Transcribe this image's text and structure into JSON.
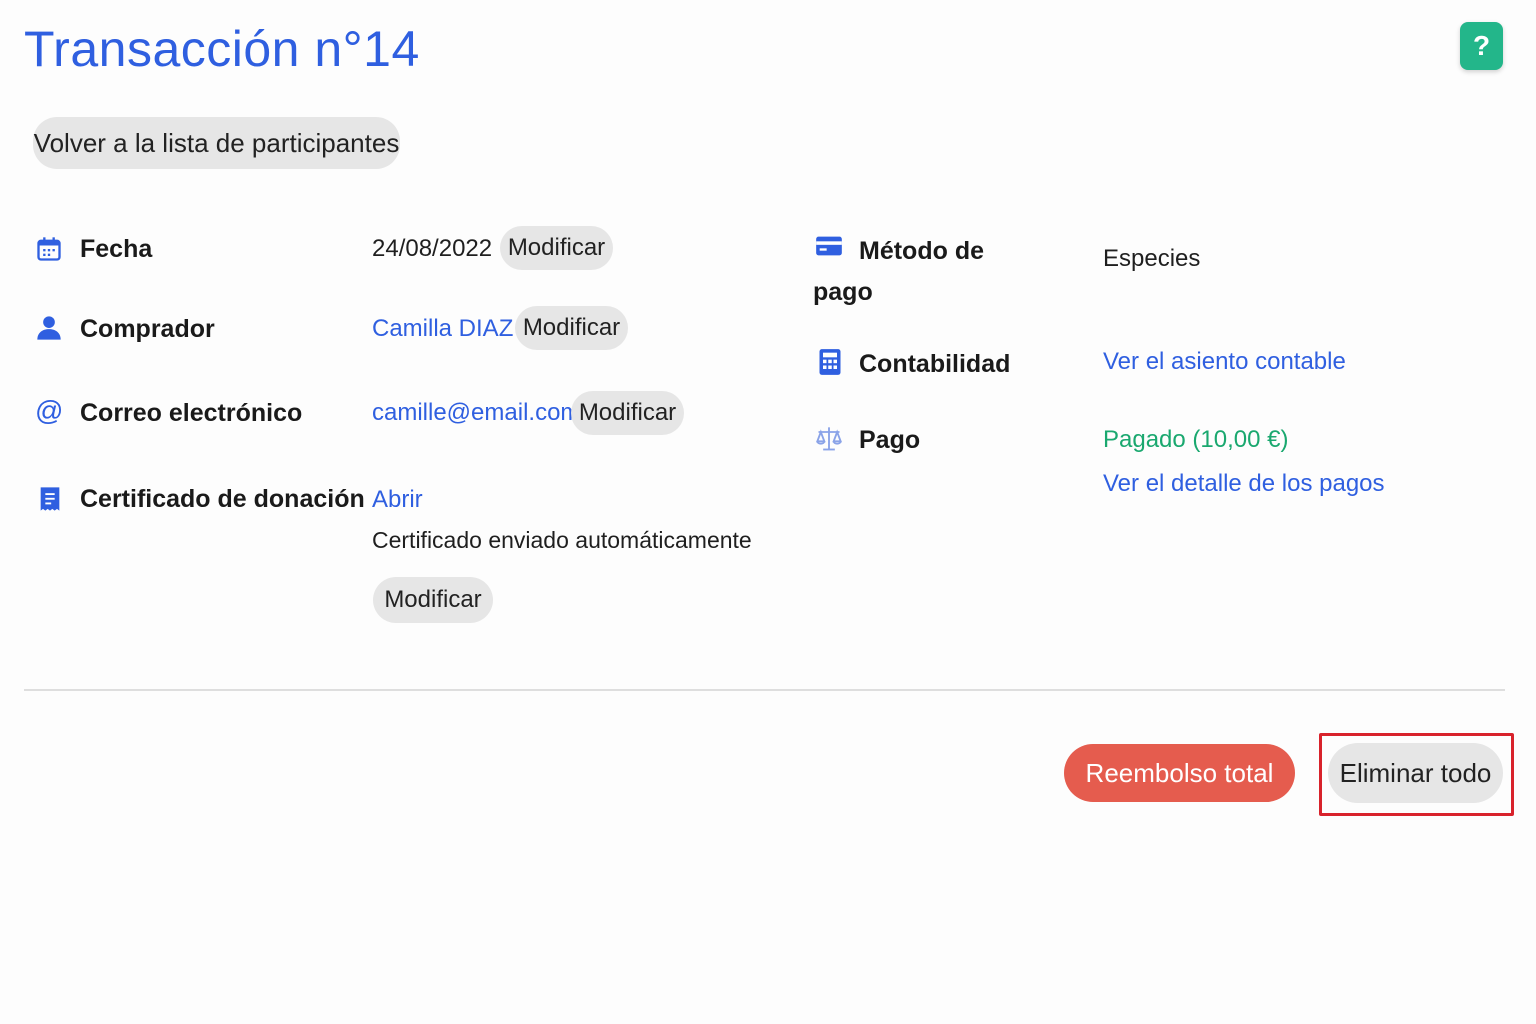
{
  "header": {
    "title": "Transacción n°14",
    "help_label": "?",
    "back_label": "Volver a la lista de participantes"
  },
  "left_fields": {
    "date": {
      "label": "Fecha",
      "value": "24/08/2022",
      "action": "Modificar",
      "icon": "calendar-icon"
    },
    "buyer": {
      "label": "Comprador",
      "value": "Camilla DIAZ",
      "action": "Modificar",
      "icon": "user-icon"
    },
    "email": {
      "label": "Correo electrónico",
      "value": "camille@email.com",
      "action": "Modificar",
      "icon": "at-icon"
    },
    "certificate": {
      "label": "Certificado de donación",
      "link": "Abrir",
      "note": "Certificado enviado automáticamente",
      "action": "Modificar",
      "icon": "receipt-icon"
    }
  },
  "right_fields": {
    "payment_method": {
      "label_line1": "Método de",
      "label_line2": "pago",
      "value": "Especies",
      "icon": "credit-card-icon"
    },
    "accounting": {
      "label": "Contabilidad",
      "link": "Ver el asiento contable",
      "icon": "calculator-icon"
    },
    "payment": {
      "label": "Pago",
      "status": "Pagado (10,00 €)",
      "link": "Ver el detalle de los pagos",
      "icon": "scale-icon"
    }
  },
  "footer": {
    "refund_label": "Reembolso total",
    "delete_label": "Eliminar todo"
  },
  "colors": {
    "accent": "#2f5fe0",
    "help": "#23b68a",
    "refund": "#e55c4e",
    "paid": "#1aa86f",
    "highlight_border": "#d8222b"
  }
}
